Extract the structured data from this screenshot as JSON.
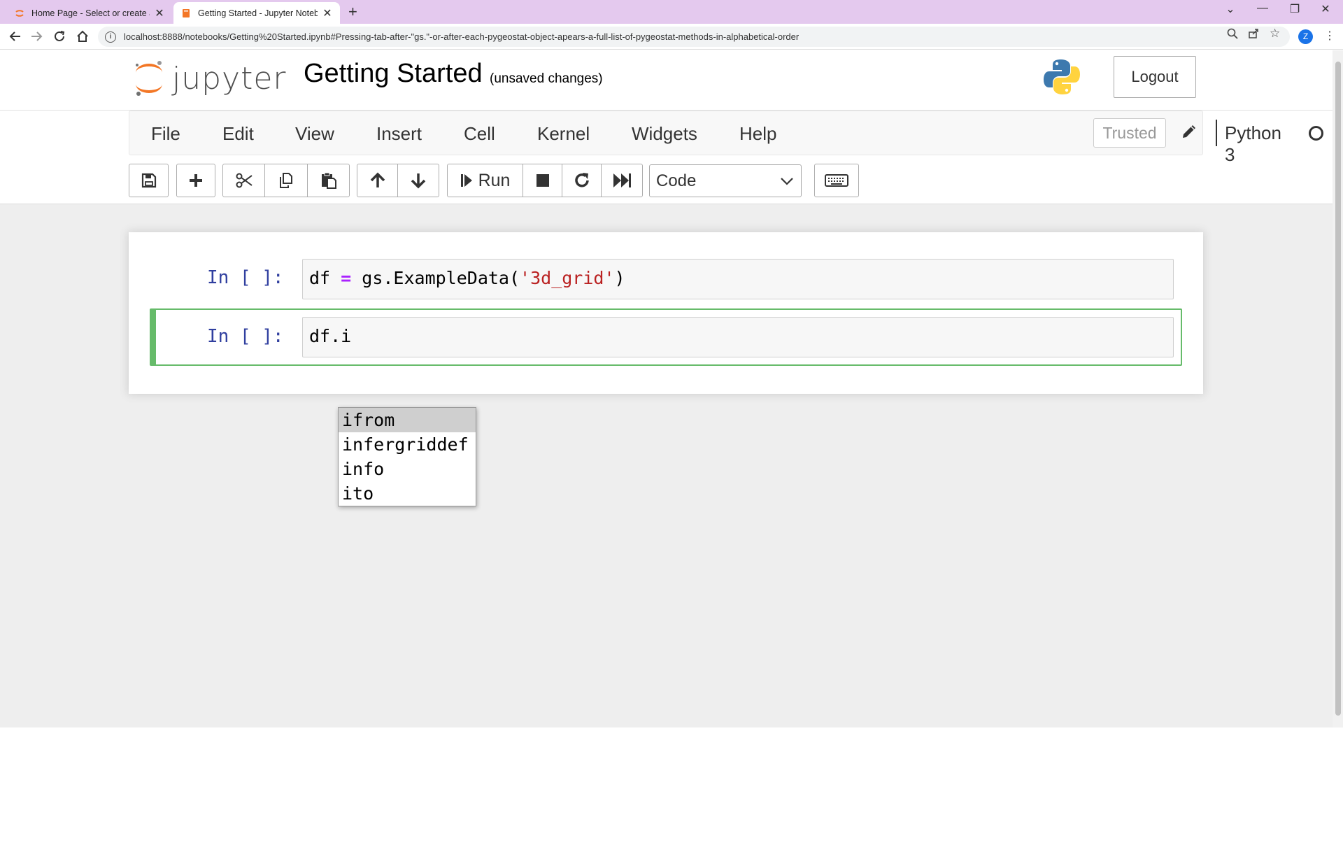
{
  "browser": {
    "tabs": [
      {
        "title": "Home Page - Select or create a n",
        "favicon": "jupyter-icon",
        "active": false
      },
      {
        "title": "Getting Started - Jupyter Notebo",
        "favicon": "notebook-icon",
        "active": true
      }
    ],
    "url": "localhost:8888/notebooks/Getting%20Started.ipynb#Pressing-tab-after-\"gs.\"-or-after-each-pygeostat-object-apears-a-full-list-of-pygeostat-methods-in-alphabetical-order",
    "profile_initial": "Z"
  },
  "header": {
    "logo_text": "jupyter",
    "notebook_title": "Getting Started",
    "save_status": "(unsaved changes)",
    "logout_label": "Logout"
  },
  "menubar": {
    "items": [
      "File",
      "Edit",
      "View",
      "Insert",
      "Cell",
      "Kernel",
      "Widgets",
      "Help"
    ],
    "trusted_label": "Trusted",
    "kernel_name": "Python 3"
  },
  "toolbar": {
    "run_label": "Run",
    "cell_type": "Code"
  },
  "cells": [
    {
      "prompt": "In [ ]:",
      "code_parts": [
        "df",
        " = ",
        "gs.ExampleData(",
        "'3d_grid'",
        ")"
      ]
    },
    {
      "prompt": "In [ ]:",
      "code": "df.i"
    }
  ],
  "completer": {
    "options": [
      "ifrom",
      "infergriddef",
      "info",
      "ito"
    ],
    "selected_index": 0
  },
  "colors": {
    "tab_strip": "#e4c9ee",
    "selected_cell_border": "#66bb6a",
    "prompt": "#303f9f",
    "string": "#ba2121",
    "operator": "#aa22ff"
  }
}
